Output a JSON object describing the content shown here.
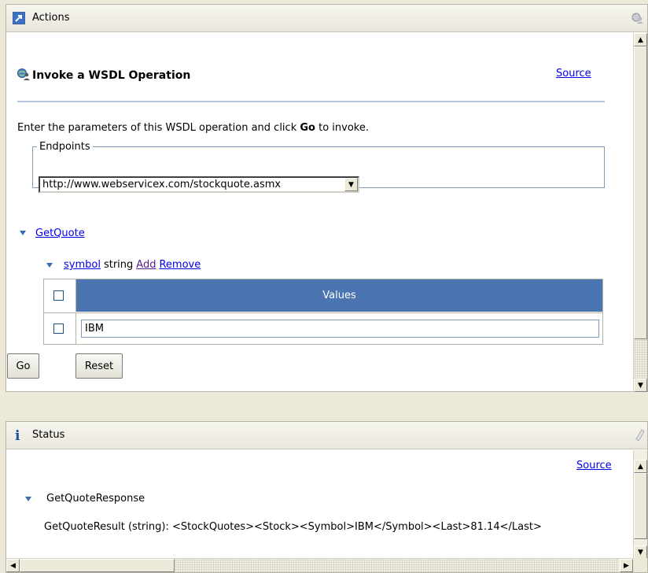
{
  "actions": {
    "title": "Actions",
    "heading": "Invoke a WSDL Operation",
    "source_label": "Source",
    "instructions_before": "Enter the parameters of this WSDL operation and click ",
    "instructions_bold": "Go",
    "instructions_after": " to invoke.",
    "endpoints_legend": "Endpoints",
    "endpoint_value": "http://www.webservicex.com/stockquote.asmx",
    "operation": "GetQuote",
    "param": {
      "name": "symbol",
      "type": "string",
      "add_label": "Add",
      "remove_label": "Remove"
    },
    "table": {
      "header": "Values",
      "rows": [
        "IBM"
      ]
    },
    "go_label": "Go",
    "reset_label": "Reset"
  },
  "status": {
    "title": "Status",
    "source_label": "Source",
    "response_name": "GetQuoteResponse",
    "result_line": "GetQuoteResult (string):  <StockQuotes><Stock><Symbol>IBM</Symbol><Last>81.14</Last>"
  },
  "icons": {
    "actions": "arrow-window-icon",
    "wsdl": "globe-person-icon",
    "status": "info-icon",
    "eraser": "eraser-icon"
  },
  "colors": {
    "accent": "#4a75b0",
    "link": "#0000ee",
    "visited_link": "#551a8b",
    "info_icon": "#1f4da5"
  }
}
